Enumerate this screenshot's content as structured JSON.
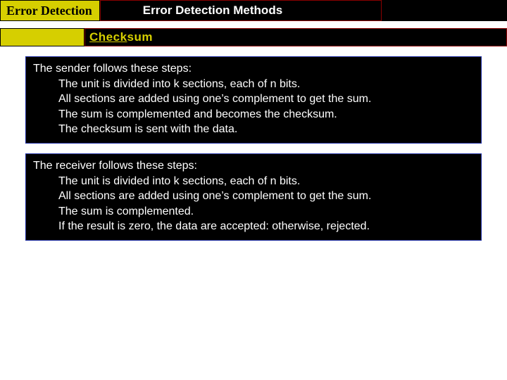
{
  "top": {
    "left_title": "Error Detection",
    "main_title": "Error Detection Methods"
  },
  "strip": {
    "label_first": "Check",
    "label_rest": "sum"
  },
  "sender": {
    "lead": "The sender follows these steps:",
    "items": [
      "The unit is divided into k sections, each of n bits.",
      "All sections are added using one’s complement to get the sum.",
      "The sum is complemented and becomes the checksum.",
      "The checksum is sent with the data."
    ]
  },
  "receiver": {
    "lead": "The receiver follows these steps:",
    "items": [
      "The unit is divided into k sections, each of n bits.",
      "All sections are added using one’s complement to get the sum.",
      "The sum is complemented.",
      "If the result is zero, the data are accepted: otherwise, rejected."
    ]
  }
}
